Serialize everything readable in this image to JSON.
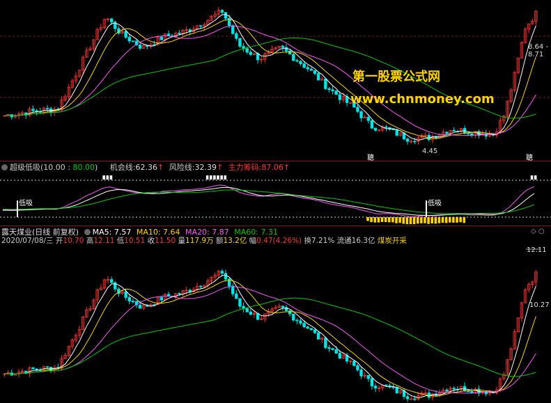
{
  "watermark": {
    "line1": "第一股票公式网",
    "line2": "www.chnmoney.com"
  },
  "main_chart": {
    "high_tag": "8.64 - 8.71",
    "low_tag": "4.45",
    "marker_left": "聰",
    "marker_right": "聰"
  },
  "indicator": {
    "name": "超级低吸",
    "param1": "10.00",
    "param2": "80.00",
    "chance_label": "机会线:",
    "chance_value": "62.36",
    "risk_label": "风险线:",
    "risk_value": "32.39",
    "main_label": "主力筹码:",
    "main_value": "87.06",
    "signal_left": "低吸",
    "signal_right": "低吸"
  },
  "stock": {
    "name": "露天煤业",
    "period": "(日线 前复权)",
    "ma5_label": "MA5:",
    "ma5": "7.57",
    "ma10_label": "MA10:",
    "ma10": "7.64",
    "ma20_label": "MA20:",
    "ma20": "7.87",
    "ma60_label": "MA60:",
    "ma60": "7.31",
    "info_date": "2020/07/08/三",
    "open_label": "开",
    "open": "10.70",
    "high_label": "高",
    "high": "12.11",
    "low_label": "低",
    "low": "10.51",
    "close_label": "收",
    "close": "11.50",
    "vol_label": "量",
    "vol": "117.9万",
    "amt_label": "额",
    "amt": "13.2亿",
    "chg_label": "幅",
    "chg": "0.47(4.26%)",
    "turnover_label": "换",
    "turnover": "7.21%",
    "float_label": "流通",
    "float": "16.3亿",
    "concept": "煤炭开采"
  },
  "lower_chart": {
    "price_high": "12.11",
    "price_close": "10.27"
  },
  "colors": {
    "up": "#ff3333",
    "down": "#00e5e5",
    "ma5": "#ffffff",
    "ma10": "#ffd400",
    "ma20": "#ff55ff",
    "ma60": "#00cc00"
  }
}
